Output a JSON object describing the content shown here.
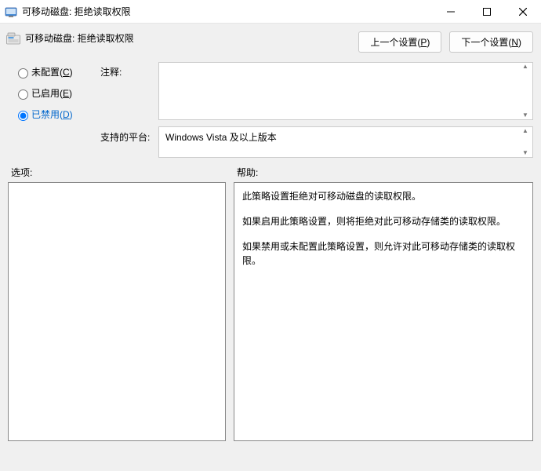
{
  "window": {
    "title": "可移动磁盘: 拒绝读取权限"
  },
  "header": {
    "title": "可移动磁盘: 拒绝读取权限",
    "prev_btn": "上一个设置(P)",
    "next_btn": "下一个设置(N)"
  },
  "state": {
    "radios": {
      "not_configured": "未配置(C)",
      "enabled": "已启用(E)",
      "disabled": "已禁用(D)"
    },
    "selected": "disabled"
  },
  "labels": {
    "comment": "注释:",
    "supported": "支持的平台:",
    "options": "选项:",
    "help": "帮助:"
  },
  "fields": {
    "comment_value": "",
    "supported_value": "Windows Vista 及以上版本"
  },
  "help": {
    "p1": "此策略设置拒绝对可移动磁盘的读取权限。",
    "p2": "如果启用此策略设置，则将拒绝对此可移动存储类的读取权限。",
    "p3": "如果禁用或未配置此策略设置，则允许对此可移动存储类的读取权限。"
  }
}
